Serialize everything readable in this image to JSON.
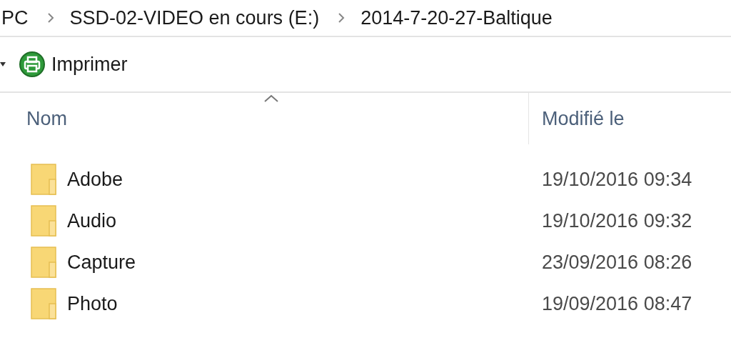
{
  "breadcrumb": [
    "PC",
    "SSD-02-VIDEO en cours (E:)",
    "2014-7-20-27-Baltique"
  ],
  "toolbar": {
    "label": "Imprimer"
  },
  "columns": [
    {
      "label": "Nom",
      "sorted": true
    },
    {
      "label": "Modifié le",
      "sorted": false
    }
  ],
  "rows": [
    {
      "name": "Adobe",
      "modified": "19/10/2016 09:34"
    },
    {
      "name": "Audio",
      "modified": "19/10/2016 09:32"
    },
    {
      "name": "Capture",
      "modified": "23/09/2016 08:26"
    },
    {
      "name": "Photo",
      "modified": "19/09/2016 08:47"
    }
  ]
}
